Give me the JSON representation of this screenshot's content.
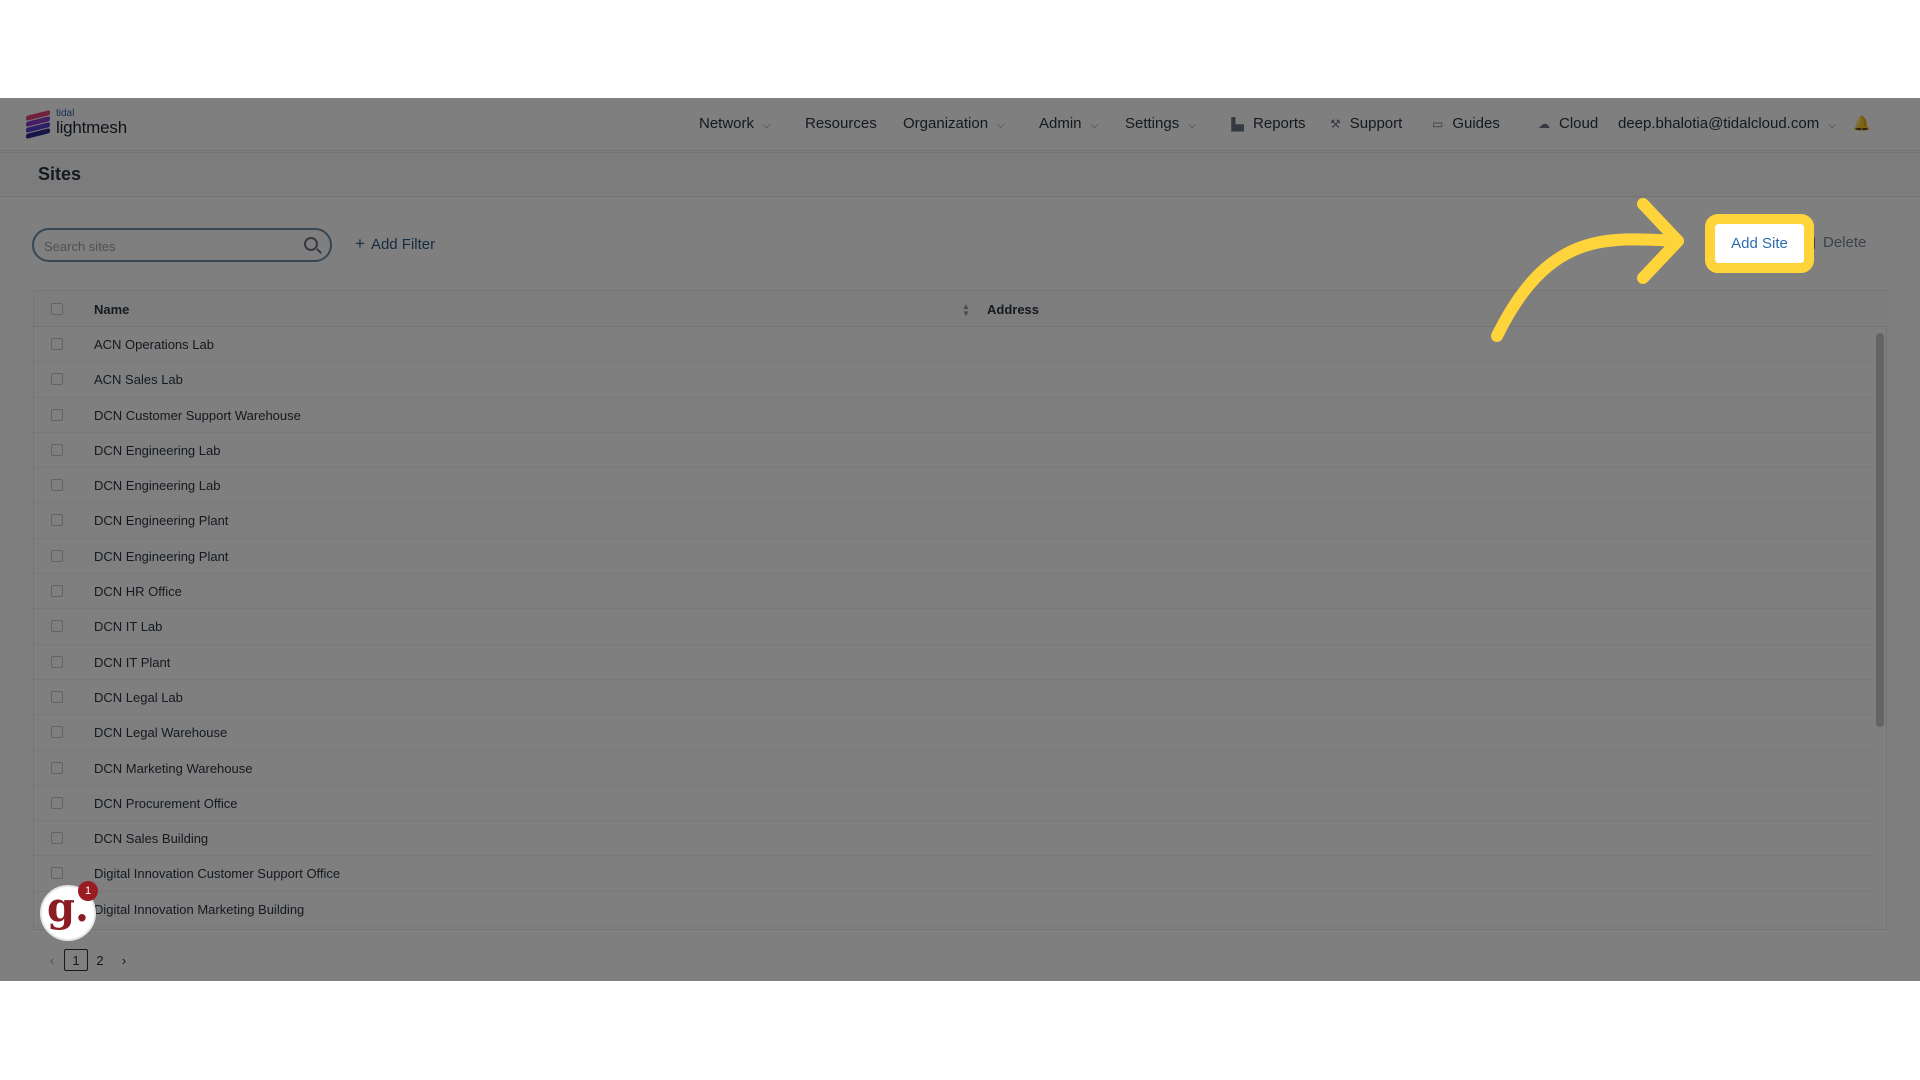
{
  "logo": {
    "small": "tidal",
    "big": "lightmesh"
  },
  "nav": {
    "network": "Network",
    "resources": "Resources",
    "organization": "Organization",
    "admin": "Admin",
    "settings": "Settings",
    "reports": "Reports",
    "support": "Support",
    "guides": "Guides",
    "cloud": "Cloud",
    "user": "deep.bhalotia@tidalcloud.com"
  },
  "page": {
    "title": "Sites"
  },
  "toolbar": {
    "search_placeholder": "Search sites",
    "add_filter": "Add Filter",
    "add_site": "Add Site",
    "delete": "Delete"
  },
  "table": {
    "columns": [
      "Name",
      "Address"
    ],
    "rows": [
      "ACN Operations Lab",
      "ACN Sales Lab",
      "DCN Customer Support Warehouse",
      "DCN Engineering Lab",
      "DCN Engineering Lab",
      "DCN Engineering Plant",
      "DCN Engineering Plant",
      "DCN HR Office",
      "DCN IT Lab",
      "DCN IT Plant",
      "DCN Legal Lab",
      "DCN Legal Warehouse",
      "DCN Marketing Warehouse",
      "DCN Procurement Office",
      "DCN Sales Building",
      "Digital Innovation Customer Support Office",
      "Digital Innovation Marketing Building"
    ]
  },
  "pagination": {
    "pages": [
      "1",
      "2"
    ],
    "current": "1"
  },
  "widget": {
    "letter": "g.",
    "badge": "1"
  },
  "colors": {
    "highlight": "#ffd43b",
    "overlay": "rgba(0,0,0,0.5)",
    "link": "#2b6cb0"
  }
}
